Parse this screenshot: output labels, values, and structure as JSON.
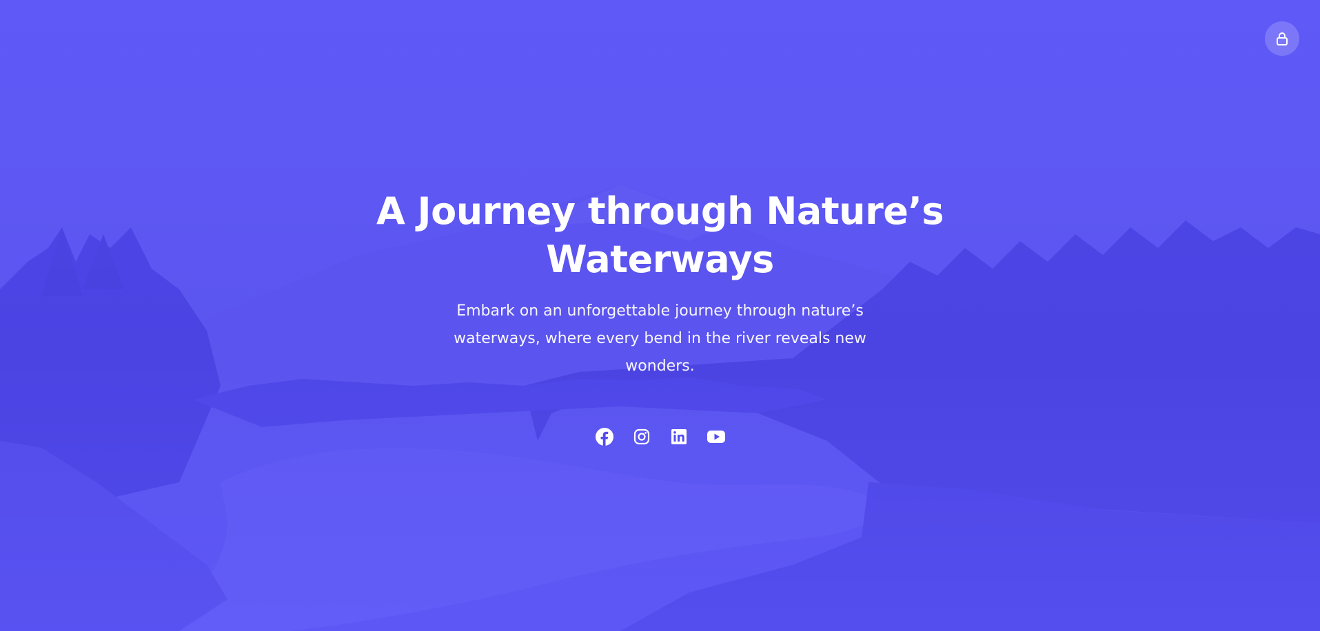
{
  "hero": {
    "title": "A Journey through Nature’s Waterways",
    "subtitle": "Embark on an unforgettable journey through nature’s waterways, where every bend in the river reveals new wonders.",
    "overlay_color": "#524cf0"
  },
  "header": {
    "lock_icon": "lock-icon"
  },
  "social": {
    "links": [
      {
        "name": "facebook",
        "icon": "facebook-icon"
      },
      {
        "name": "instagram",
        "icon": "instagram-icon"
      },
      {
        "name": "linkedin",
        "icon": "linkedin-icon"
      },
      {
        "name": "youtube",
        "icon": "youtube-icon"
      }
    ]
  }
}
